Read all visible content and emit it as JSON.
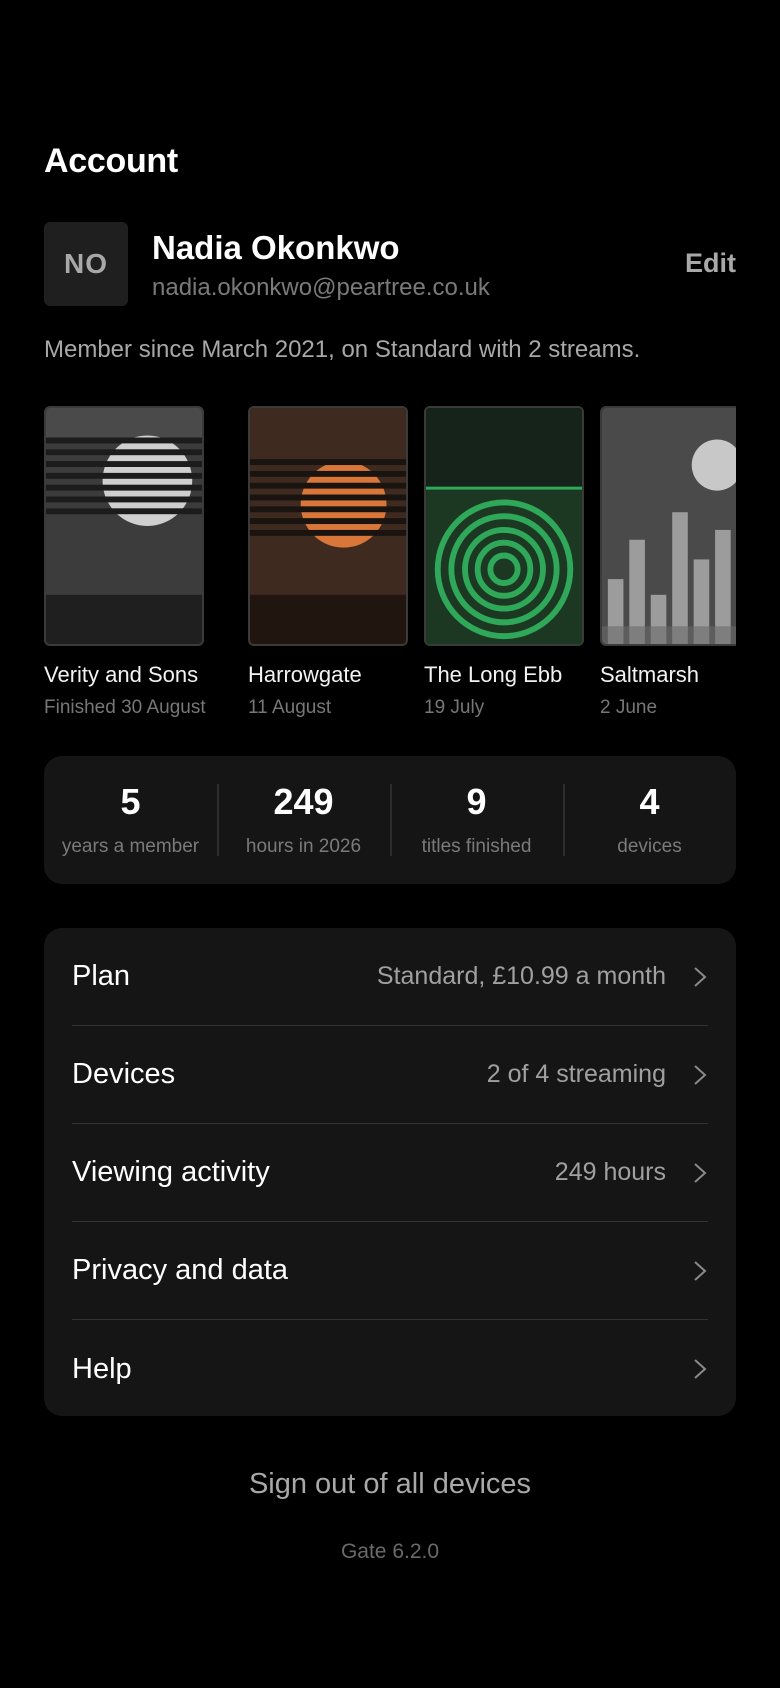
{
  "header": {
    "title": "Account"
  },
  "profile": {
    "initials": "NO",
    "name": "Nadia Okonkwo",
    "email": "nadia.okonkwo@peartree.co.uk",
    "edit_label": "Edit"
  },
  "membership": {
    "summary": "Member since March 2021, on Standard with 2 streams."
  },
  "history": [
    {
      "title": "Verity and Sons",
      "date": "Finished 30 August",
      "cover": "striped-moon-gray"
    },
    {
      "title": "Harrowgate",
      "date": "11 August",
      "cover": "striped-sun-orange"
    },
    {
      "title": "The Long Ebb",
      "date": "19 July",
      "cover": "green-rings"
    },
    {
      "title": "Saltmarsh",
      "date": "2 June",
      "cover": "bars-and-moon"
    }
  ],
  "stats": [
    {
      "value": "5",
      "label": "years a member"
    },
    {
      "value": "249",
      "label": "hours in 2026"
    },
    {
      "value": "9",
      "label": "titles finished"
    },
    {
      "value": "4",
      "label": "devices"
    }
  ],
  "settings": [
    {
      "label": "Plan",
      "value": "Standard, £10.99 a month"
    },
    {
      "label": "Devices",
      "value": "2 of 4 streaming"
    },
    {
      "label": "Viewing activity",
      "value": "249 hours"
    },
    {
      "label": "Privacy and data",
      "value": ""
    },
    {
      "label": "Help",
      "value": ""
    }
  ],
  "footer": {
    "signout_label": "Sign out of all devices",
    "version": "Gate 6.2.0"
  },
  "colors": {
    "background": "#000000",
    "panel": "#151515",
    "accent_orange": "#d9773a",
    "accent_green": "#2fa85a"
  }
}
